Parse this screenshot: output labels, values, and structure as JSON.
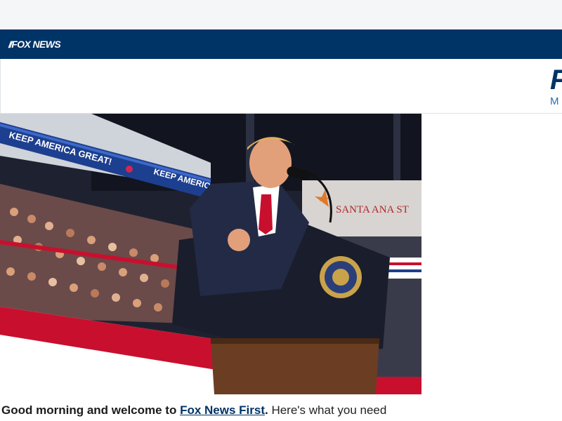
{
  "navbar": {
    "logo_text": "FOX NEWS",
    "logo_icon": "fox-news-logo-icon",
    "background": "#003366"
  },
  "masthead": {
    "big_letter": "F",
    "small_letter": "M"
  },
  "hero": {
    "banner_left": "KEEP AMERICA GREAT!",
    "banner_right": "KEEP AMERICA",
    "venue_sign": "SANTA ANA ST"
  },
  "article": {
    "intro_bold": "Good morning and welcome to ",
    "link_text": "Fox News First",
    "after_link": ".",
    "rest_text": " Here's what you need"
  },
  "colors": {
    "brand_navy": "#003366",
    "accent_blue": "#2a6fb3",
    "stage_red": "#c8102e"
  }
}
